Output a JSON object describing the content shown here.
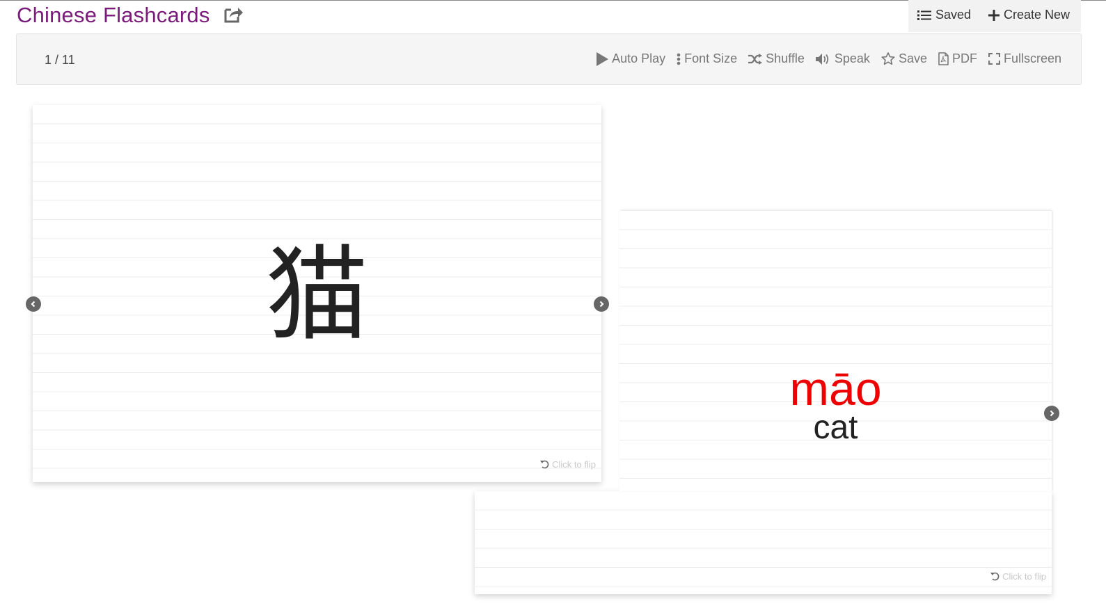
{
  "header": {
    "title": "Chinese Flashcards",
    "saved_label": "Saved",
    "create_label": "Create New"
  },
  "toolbar": {
    "counter": "1 / 11",
    "auto_play": "Auto Play",
    "font_size": "Font Size",
    "shuffle": "Shuffle",
    "speak": "Speak",
    "save": "Save",
    "pdf": "PDF",
    "fullscreen": "Fullscreen"
  },
  "card": {
    "character": "猫",
    "pinyin": "māo",
    "english": "cat",
    "flip_hint": "Click to flip"
  },
  "colors": {
    "title": "#7a1a7a",
    "pinyin": "#ee0000"
  },
  "icons": [
    "share-icon",
    "list-icon",
    "plus-icon",
    "play-icon",
    "dots-vertical-icon",
    "shuffle-icon",
    "speaker-icon",
    "star-icon",
    "pdf-file-icon",
    "expand-icon",
    "rotate-icon",
    "chevron-left-icon",
    "chevron-right-icon"
  ]
}
